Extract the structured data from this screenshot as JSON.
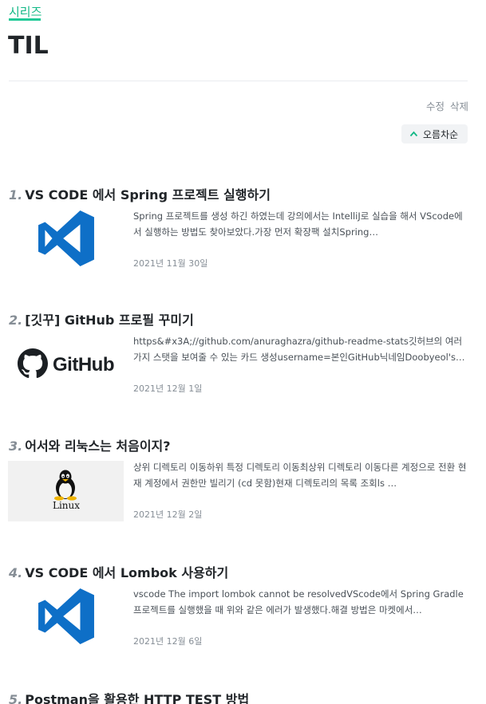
{
  "header": {
    "series_label": "시리즈",
    "title": "TIL"
  },
  "actions": {
    "edit": "수정",
    "delete": "삭제"
  },
  "sort": {
    "label": "오름차순"
  },
  "posts": [
    {
      "number": "1.",
      "title": "VS CODE 에서 Spring 프로젝트 실행하기",
      "thumbnail": "vscode-logo",
      "description": "Spring 프로젝트를 생성 하긴 하였는데 강의에서는 IntelliJ로 실습을 해서 VScode에서 실행하는 방법도 찾아보았다.가장 먼저 확장팩 설치Spring…",
      "date": "2021년 11월 30일"
    },
    {
      "number": "2.",
      "title": "[깃꾸] GitHub 프로필 꾸미기",
      "thumbnail": "github-logo",
      "thumbnail_text": "GitHub",
      "description": "https&#x3A;//github.com/anuraghazra/github-readme-stats깃허브의 여러가지 스탯을 보여줄 수 있는 카드 생성username=본인GitHub닉네임Doobyeol's…",
      "date": "2021년 12월 1일"
    },
    {
      "number": "3.",
      "title": "어서와 리눅스는 처음이지?",
      "thumbnail": "linux-tux-logo",
      "thumbnail_text": "Linux",
      "description": "상위 디렉토리 이동하위 특정 디렉토리 이동최상위 디렉토리 이동다른 계정으로 전환 현재 계정에서 권한만 빌리기 (cd 못함)현재 디렉토리의 목록 조회ls …",
      "date": "2021년 12월 2일"
    },
    {
      "number": "4.",
      "title": "VS CODE 에서 Lombok 사용하기",
      "thumbnail": "vscode-logo",
      "description": "vscode The import lombok cannot be resolvedVScode에서 Spring Gradle 프로젝트를 실행했을 때 위와 같은 에러가 발생했다.해결 방법은 마켓에서…",
      "date": "2021년 12월 6일"
    },
    {
      "number": "5.",
      "title": "Postman을 활용한 HTTP TEST 방법"
    }
  ],
  "colors": {
    "accent": "#12b886",
    "vscode_blue": "#0e6fc7",
    "text_primary": "#212529",
    "text_muted": "#868e96"
  }
}
